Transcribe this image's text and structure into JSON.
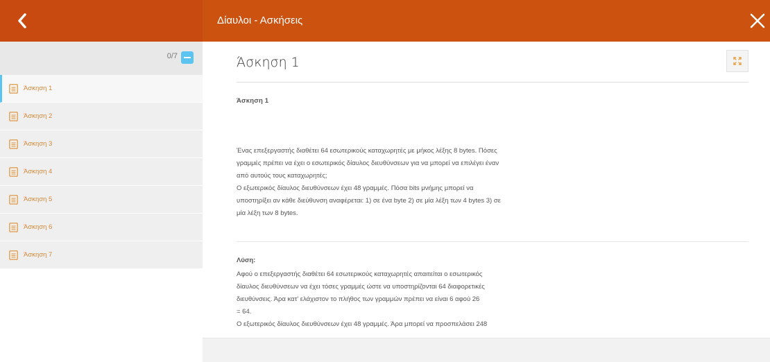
{
  "header": {
    "title": "Δίαυλοι - Ασκήσεις",
    "color_left": "#c84a10",
    "color_right": "#cc5210"
  },
  "sidebar": {
    "progress": "0/7",
    "items": [
      {
        "label": "Άσκηση 1"
      },
      {
        "label": "Άσκηση 2"
      },
      {
        "label": "Άσκηση 3"
      },
      {
        "label": "Άσκηση 4"
      },
      {
        "label": "Άσκηση 5"
      },
      {
        "label": "Άσκηση 6"
      },
      {
        "label": "Άσκηση 7"
      }
    ],
    "accent": "#5bc4f0"
  },
  "main": {
    "title": "Άσκηση 1",
    "subheading": "Άσκηση 1",
    "problem_lines": [
      "Ένας επεξεργαστής διαθέτει 64 εσωτερικούς καταχωρητές με μήκος λέξης 8 bytes. Πόσες",
      "γραμμές πρέπει να έχει ο εσωτερικός δίαυλος διευθύνσεων για να μπορεί να επιλέγει έναν",
      "από αυτούς τους καταχωρητές;",
      "Ο εξωτερικός δίαυλος διευθύνσεων έχει 48 γραμμές. Πόσα bits μνήμης μπορεί να",
      "υποστηρίξει αν κάθε διεύθυνση αναφέρεται: 1) σε ένα byte 2) σε μία λέξη των 4 bytes 3) σε",
      "μία λέξη των 8 bytes."
    ],
    "solution_label": "Λύση:",
    "solution_lines": [
      "Αφού ο επεξεργαστής διαθέτει 64 εσωτερικούς καταχωρητές απαιτείται ο εσωτερικός",
      "δίαυλος διευθύνσεων να έχει τόσες γραμμές ώστε να υποστηρίζονται 64 διαφορετικές",
      "διευθύνσεις. Άρα κατ' ελάχιστον το πλήθος των γραμμών πρέπει να είναι 6 αφού 26",
      "= 64.",
      "Ο εξωτερικός δίαυλος διευθύνσεων έχει 48 γραμμές. Άρα μπορεί να προσπελάσει 248"
    ]
  },
  "icons": {
    "back": "chevron-left-icon",
    "close": "close-icon",
    "expand": "expand-icon",
    "document": "document-icon"
  }
}
